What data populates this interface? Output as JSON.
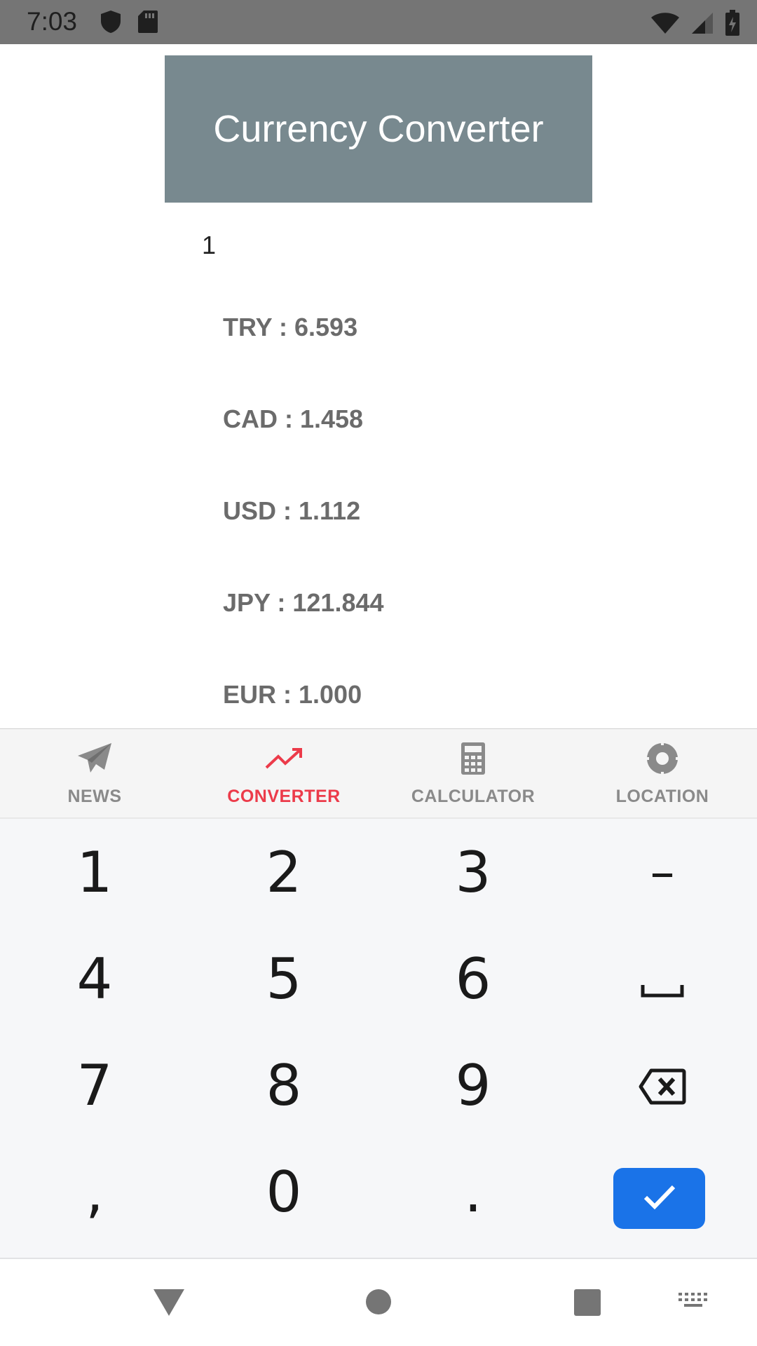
{
  "status_bar": {
    "time": "7:03",
    "icons": [
      "shield-icon",
      "sd-card-icon",
      "wifi-icon",
      "signal-icon",
      "battery-charging-icon"
    ]
  },
  "header": {
    "title": "Currency Converter"
  },
  "amount": {
    "value": "1"
  },
  "rates": [
    {
      "label": "TRY : 6.593"
    },
    {
      "label": "CAD : 1.458"
    },
    {
      "label": "USD : 1.112"
    },
    {
      "label": "JPY : 121.844"
    },
    {
      "label": "EUR : 1.000"
    }
  ],
  "bottom_nav": {
    "active_color": "#ec3b4a",
    "items": [
      {
        "label": "NEWS",
        "icon": "paper-plane-icon",
        "active": false
      },
      {
        "label": "CONVERTER",
        "icon": "trending-up-icon",
        "active": true
      },
      {
        "label": "CALCULATOR",
        "icon": "calculator-icon",
        "active": false
      },
      {
        "label": "LOCATION",
        "icon": "location-target-icon",
        "active": false
      }
    ]
  },
  "keyboard": {
    "keys": [
      [
        "1",
        "2",
        "3",
        "–"
      ],
      [
        "4",
        "5",
        "6",
        "space"
      ],
      [
        "7",
        "8",
        "9",
        "backspace"
      ],
      [
        ",",
        "0",
        ".",
        "enter"
      ]
    ],
    "enter_color": "#1a73e8"
  },
  "system_nav": [
    "back-icon",
    "home-icon",
    "recents-icon",
    "keyboard-switch-icon"
  ]
}
